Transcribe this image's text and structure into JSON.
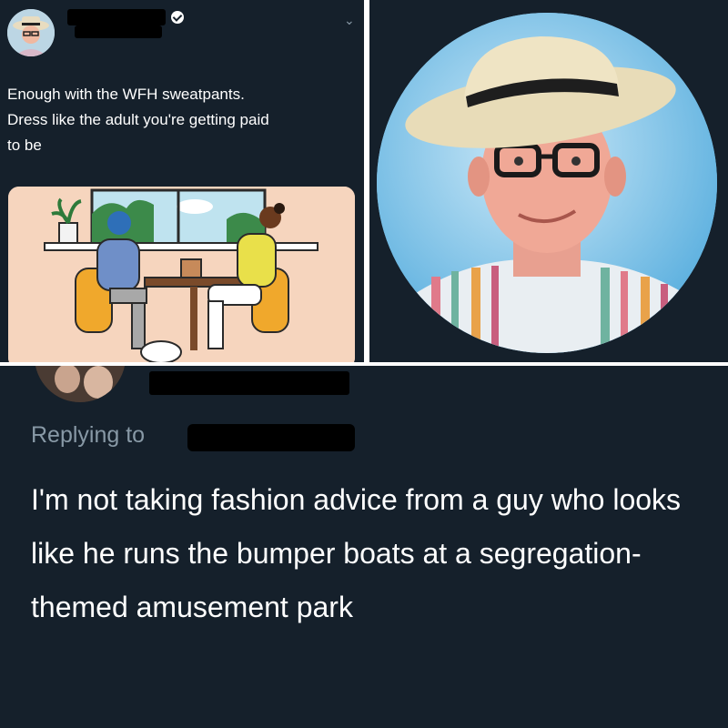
{
  "tweet": {
    "text": "Enough with the WFH sweatpants.\nDress like the adult you're getting paid\nto be",
    "illustration": "two people at a cafe table with laptop, plant and cat"
  },
  "profile_photo": {
    "subject": "man in straw hat, glasses, striped shirt"
  },
  "reply": {
    "replying_label": "Replying to",
    "text": "I'm not taking fashion advice from a guy who looks like he runs the bumper boats at a segregation-themed amusement park"
  },
  "icons": [
    "verified-icon",
    "chevron-down-icon"
  ],
  "colors": {
    "background": "#15202b",
    "text": "#ffffff",
    "muted": "#8899a6",
    "illustration_bg": "#f6d5be",
    "photo_bg": "#7fc1e8"
  }
}
